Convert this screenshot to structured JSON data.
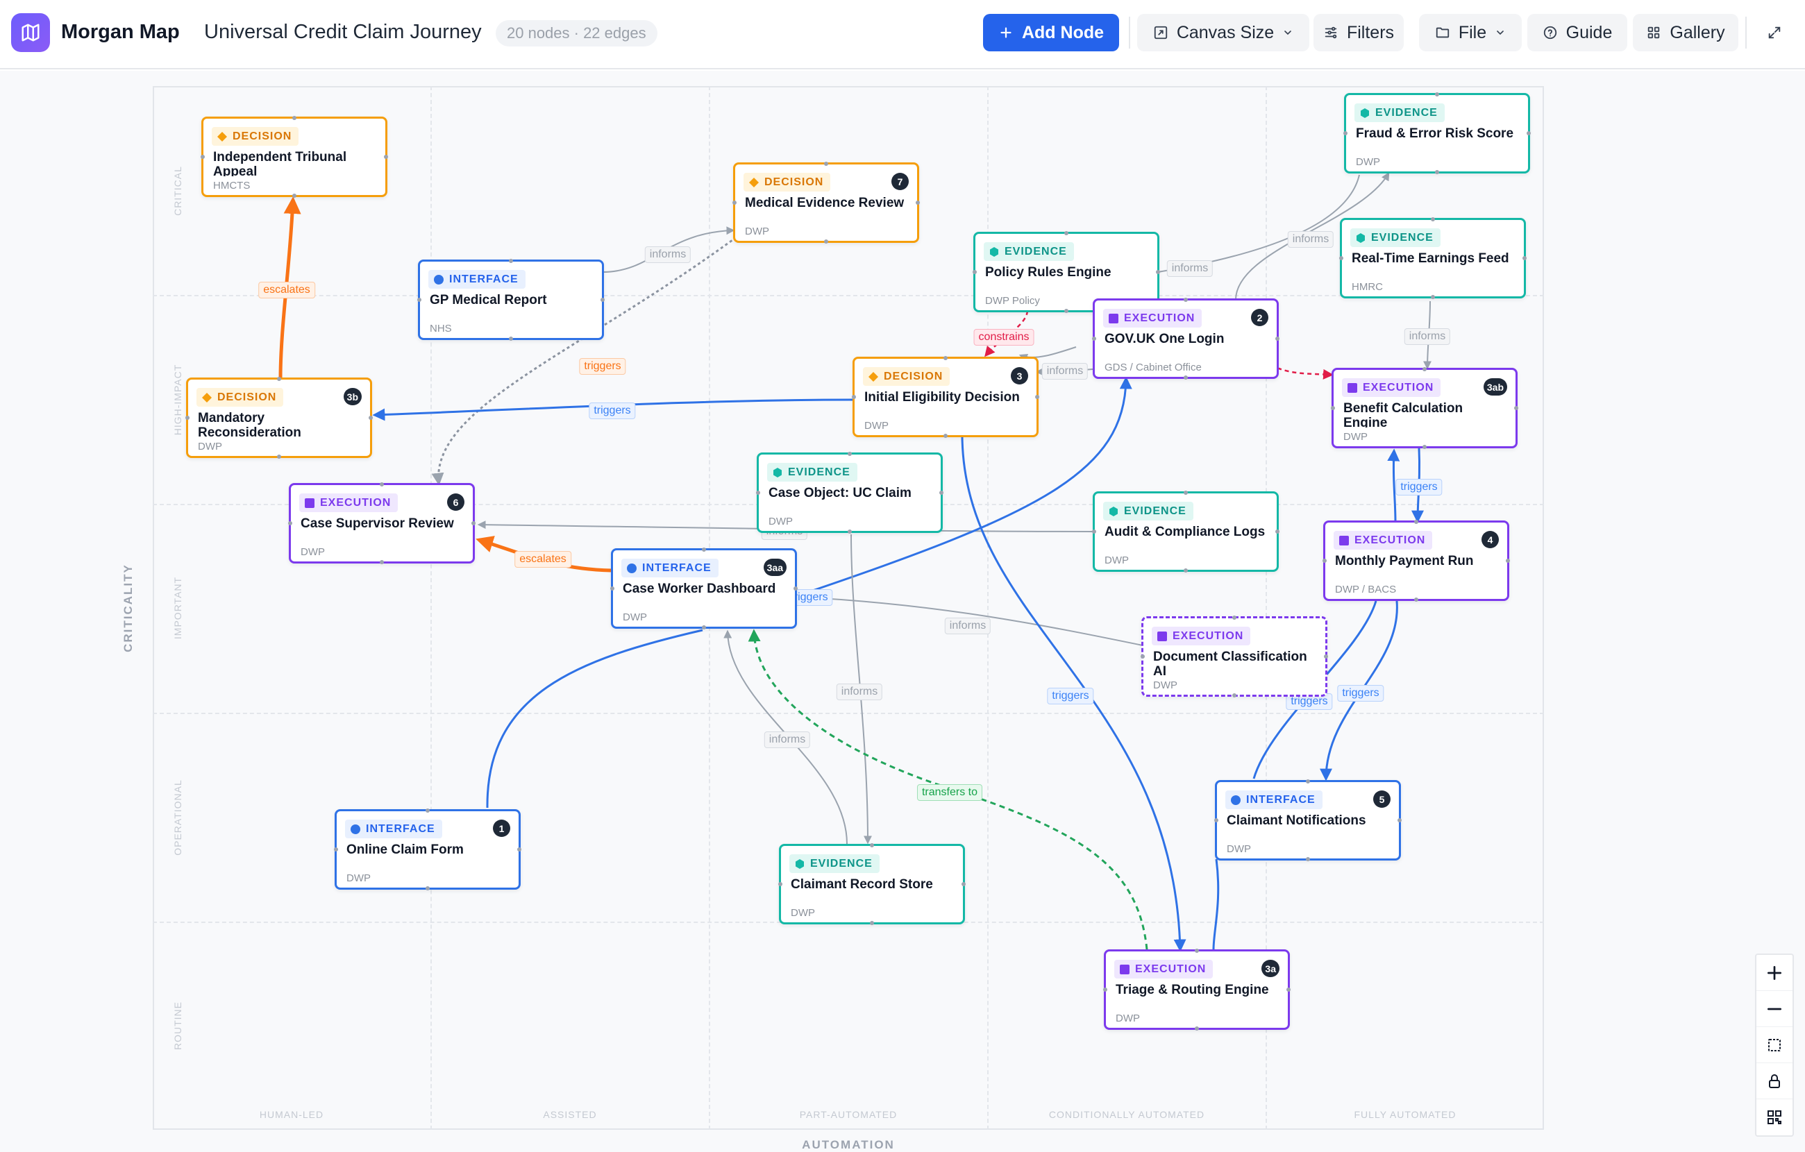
{
  "app": {
    "name": "Morgan Map"
  },
  "document": {
    "title": "Universal Credit Claim Journey",
    "count_label": "20 nodes · 22 edges"
  },
  "toolbar": {
    "add_node": "Add Node",
    "canvas_size": "Canvas Size",
    "filters": "Filters",
    "file": "File",
    "guide": "Guide",
    "gallery": "Gallery",
    "icons": {
      "logo": "map-icon",
      "add": "plus-icon",
      "canvas_size": "resize-icon",
      "filters": "sliders-icon",
      "file": "folder-icon",
      "guide": "help-circle-icon",
      "gallery": "grid-icon",
      "expand": "expand-icon"
    }
  },
  "axes": {
    "y_title": "CRITICALITY",
    "x_title": "AUTOMATION",
    "y_bands": [
      "CRITICAL",
      "HIGH-IMPACT",
      "IMPORTANT",
      "OPERATIONAL",
      "ROUTINE"
    ],
    "x_bands": [
      "HUMAN-LED",
      "ASSISTED",
      "PART-AUTOMATED",
      "CONDITIONALLY AUTOMATED",
      "FULLY AUTOMATED"
    ]
  },
  "node_types": {
    "decision": {
      "label": "DECISION",
      "color": "#f59e0b"
    },
    "interface": {
      "label": "INTERFACE",
      "color": "#2f72e6"
    },
    "evidence": {
      "label": "EVIDENCE",
      "color": "#14b8a6"
    },
    "execution": {
      "label": "EXECUTION",
      "color": "#7c3aed"
    }
  },
  "nodes": [
    {
      "id": "tribunal",
      "type": "decision",
      "type_label": "DECISION",
      "title": "Independent Tribunal Appeal",
      "owner": "HMCTS",
      "step": ""
    },
    {
      "id": "medical",
      "type": "decision",
      "type_label": "DECISION",
      "title": "Medical Evidence Review",
      "owner": "DWP",
      "step": "7"
    },
    {
      "id": "gp",
      "type": "interface",
      "type_label": "INTERFACE",
      "title": "GP Medical Report",
      "owner": "NHS",
      "step": ""
    },
    {
      "id": "policy",
      "type": "evidence",
      "type_label": "EVIDENCE",
      "title": "Policy Rules Engine",
      "owner": "DWP Policy",
      "step": ""
    },
    {
      "id": "fraud",
      "type": "evidence",
      "type_label": "EVIDENCE",
      "title": "Fraud & Error Risk Score",
      "owner": "DWP",
      "step": ""
    },
    {
      "id": "rtef",
      "type": "evidence",
      "type_label": "EVIDENCE",
      "title": "Real-Time Earnings Feed",
      "owner": "HMRC",
      "step": ""
    },
    {
      "id": "govuk",
      "type": "execution",
      "type_label": "EXECUTION",
      "title": "GOV.UK One Login",
      "owner": "GDS / Cabinet Office",
      "step": "2"
    },
    {
      "id": "mandatory",
      "type": "decision",
      "type_label": "DECISION",
      "title": "Mandatory Reconsideration",
      "owner": "DWP",
      "step": "3b"
    },
    {
      "id": "eligibility",
      "type": "decision",
      "type_label": "DECISION",
      "title": "Initial Eligibility Decision",
      "owner": "DWP",
      "step": "3"
    },
    {
      "id": "benefit",
      "type": "execution",
      "type_label": "EXECUTION",
      "title": "Benefit Calculation Engine",
      "owner": "DWP",
      "step": "3ab"
    },
    {
      "id": "supervisor",
      "type": "execution",
      "type_label": "EXECUTION",
      "title": "Case Supervisor Review",
      "owner": "DWP",
      "step": "6"
    },
    {
      "id": "caseobj",
      "type": "evidence",
      "type_label": "EVIDENCE",
      "title": "Case Object: UC Claim",
      "owner": "DWP",
      "step": ""
    },
    {
      "id": "audit",
      "type": "evidence",
      "type_label": "EVIDENCE",
      "title": "Audit & Compliance Logs",
      "owner": "DWP",
      "step": ""
    },
    {
      "id": "monthly",
      "type": "execution",
      "type_label": "EXECUTION",
      "title": "Monthly Payment Run",
      "owner": "DWP / BACS",
      "step": "4"
    },
    {
      "id": "dashboard",
      "type": "interface",
      "type_label": "INTERFACE",
      "title": "Case Worker Dashboard",
      "owner": "DWP",
      "step": "3aa"
    },
    {
      "id": "docai",
      "type": "execution",
      "type_label": "EXECUTION",
      "title": "Document Classification AI",
      "owner": "DWP",
      "step": "",
      "dashed": true
    },
    {
      "id": "notifications",
      "type": "interface",
      "type_label": "INTERFACE",
      "title": "Claimant Notifications",
      "owner": "DWP",
      "step": "5"
    },
    {
      "id": "online",
      "type": "interface",
      "type_label": "INTERFACE",
      "title": "Online Claim Form",
      "owner": "DWP",
      "step": "1"
    },
    {
      "id": "record",
      "type": "evidence",
      "type_label": "EVIDENCE",
      "title": "Claimant Record Store",
      "owner": "DWP",
      "step": ""
    },
    {
      "id": "triage",
      "type": "execution",
      "type_label": "EXECUTION",
      "title": "Triage & Routing Engine",
      "owner": "DWP",
      "step": "3a"
    }
  ],
  "edge_labels": {
    "escalates_1": "escalates",
    "informs_gp": "informs",
    "triggers_dash_med": "triggers",
    "triggers_elig_mand": "triggers",
    "constrains": "constrains",
    "informs_policy": "informs",
    "informs_fraud": "informs",
    "informs_elig": "informs",
    "informs_rtef": "informs",
    "triggers_monthly_benefit": "triggers",
    "informs_caseobj": "informs",
    "escalates_2": "escalates",
    "triggers_dash_govuk": "triggers",
    "informs_docai": "informs",
    "informs_record_caseobj": "informs",
    "triggers_elig_triage": "triggers",
    "triggers_notif_monthly_1": "triggers",
    "triggers_notif_monthly_2": "triggers",
    "informs_record_dash": "informs",
    "transfers_to": "transfers to"
  },
  "edge_colors": {
    "informs": "#9aa3ae",
    "triggers": "#2f72e6",
    "escalates": "#f97316",
    "constrains": "#e11d48",
    "transfers": "#22a55b"
  },
  "zoom_controls": [
    "zoom-in-icon",
    "zoom-out-icon",
    "fit-view-icon",
    "lock-icon",
    "minimap-icon"
  ]
}
